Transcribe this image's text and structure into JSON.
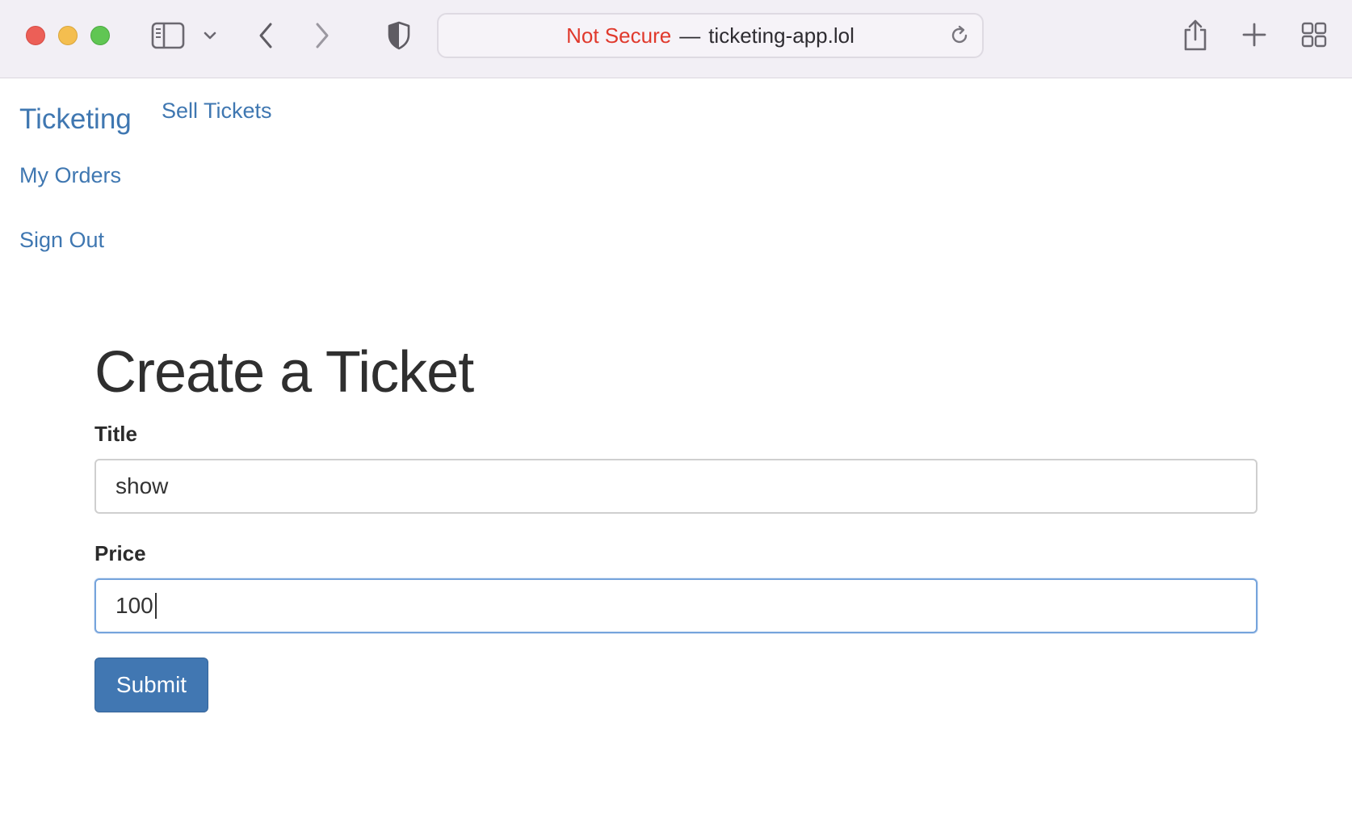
{
  "browser": {
    "security_label": "Not Secure",
    "separator": "—",
    "domain": "ticketing-app.lol",
    "colors": {
      "insecure": "#e0392c",
      "toolbar": "#f2eff5"
    }
  },
  "nav": {
    "brand": "Ticketing",
    "links": [
      {
        "label": "Sell Tickets"
      },
      {
        "label": "My Orders"
      },
      {
        "label": "Sign Out"
      }
    ]
  },
  "form": {
    "heading": "Create a Ticket",
    "title_label": "Title",
    "title_value": "show",
    "price_label": "Price",
    "price_value": "100",
    "submit_label": "Submit",
    "accent_color": "#4177b2"
  }
}
